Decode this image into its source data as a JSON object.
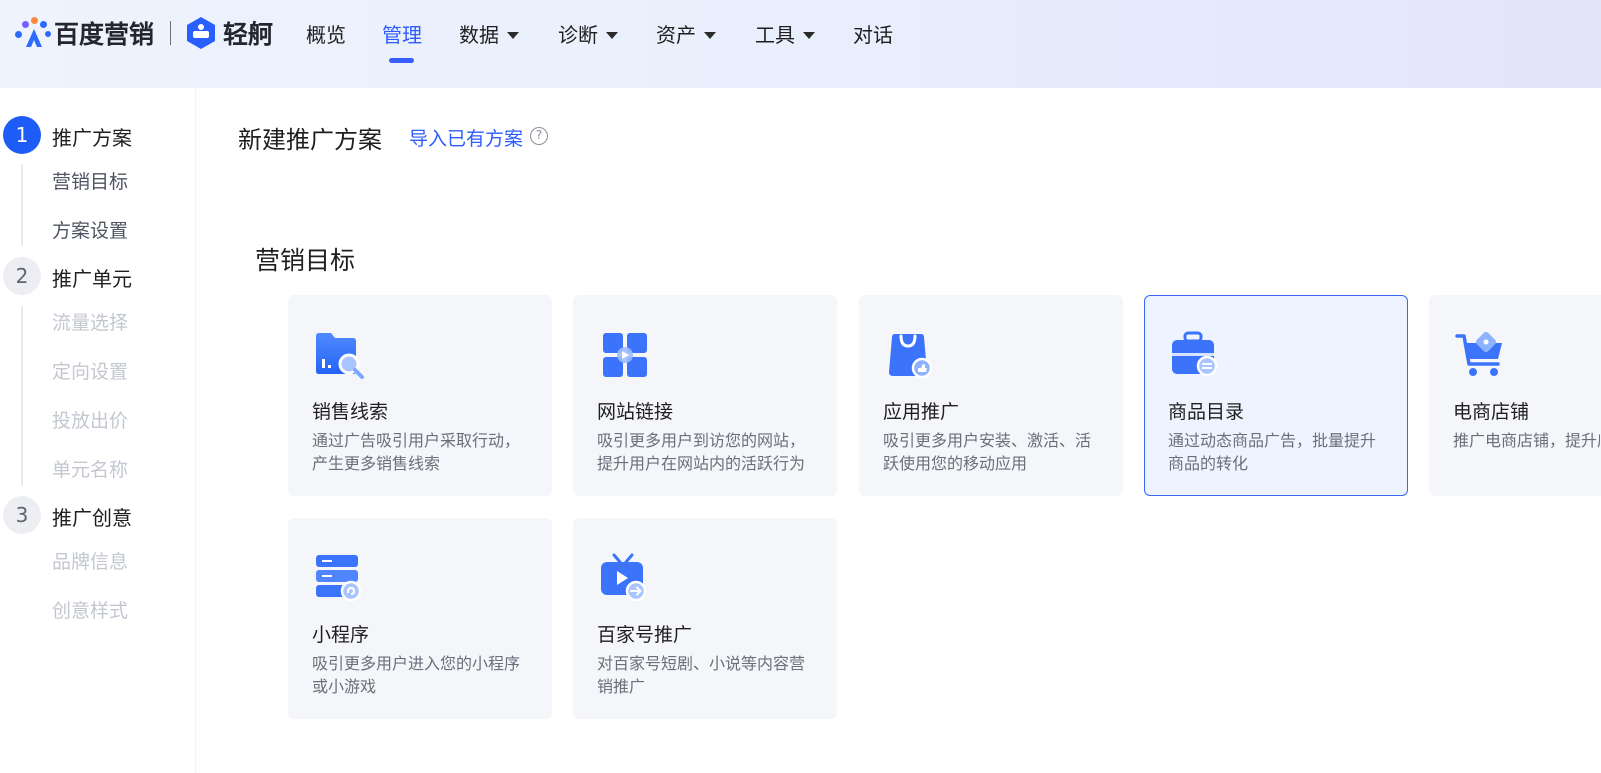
{
  "brand": {
    "name": "百度营销",
    "product": "轻舸"
  },
  "nav": {
    "items": [
      {
        "label": "概览",
        "dropdown": false,
        "active": false
      },
      {
        "label": "管理",
        "dropdown": false,
        "active": true
      },
      {
        "label": "数据",
        "dropdown": true,
        "active": false
      },
      {
        "label": "诊断",
        "dropdown": true,
        "active": false
      },
      {
        "label": "资产",
        "dropdown": true,
        "active": false
      },
      {
        "label": "工具",
        "dropdown": true,
        "active": false
      },
      {
        "label": "对话",
        "dropdown": false,
        "active": false
      }
    ]
  },
  "stepper": {
    "steps": [
      {
        "num": "1",
        "title": "推广方案",
        "state": "active",
        "subs": [
          {
            "label": "营销目标",
            "enabled": true
          },
          {
            "label": "方案设置",
            "enabled": true
          }
        ]
      },
      {
        "num": "2",
        "title": "推广单元",
        "state": "inactive",
        "subs": [
          {
            "label": "流量选择",
            "enabled": false
          },
          {
            "label": "定向设置",
            "enabled": false
          },
          {
            "label": "投放出价",
            "enabled": false
          },
          {
            "label": "单元名称",
            "enabled": false
          }
        ]
      },
      {
        "num": "3",
        "title": "推广创意",
        "state": "inactive",
        "subs": [
          {
            "label": "品牌信息",
            "enabled": false
          },
          {
            "label": "创意样式",
            "enabled": false
          }
        ]
      }
    ]
  },
  "main": {
    "title": "新建推广方案",
    "import_link": "导入已有方案",
    "section_title": "营销目标",
    "cards": [
      {
        "icon": "folder-search-icon",
        "title": "销售线索",
        "desc": "通过广告吸引用户采取行动，产生更多销售线索",
        "selected": false
      },
      {
        "icon": "web-grid-icon",
        "title": "网站链接",
        "desc": "吸引更多用户到访您的网站，提升用户在网站内的活跃行为",
        "selected": false
      },
      {
        "icon": "app-bag-icon",
        "title": "应用推广",
        "desc": "吸引更多用户安装、激活、活跃使用您的移动应用",
        "selected": false
      },
      {
        "icon": "briefcase-icon",
        "title": "商品目录",
        "desc": "通过动态商品广告，批量提升商品的转化",
        "selected": true
      },
      {
        "icon": "shopping-cart-icon",
        "title": "电商店铺",
        "desc": "推广电商店铺，提升店铺销量",
        "selected": false
      },
      {
        "icon": "mini-program-icon",
        "title": "小程序",
        "desc": "吸引更多用户进入您的小程序或小游戏",
        "selected": false
      },
      {
        "icon": "tv-share-icon",
        "title": "百家号推广",
        "desc": "对百家号短剧、小说等内容营销推广",
        "selected": false
      }
    ]
  },
  "colors": {
    "accent": "#2e5bff",
    "step_active": "#1d5cf6",
    "card_bg": "#f5f6f9",
    "card_selected_border": "#3a66f6"
  }
}
